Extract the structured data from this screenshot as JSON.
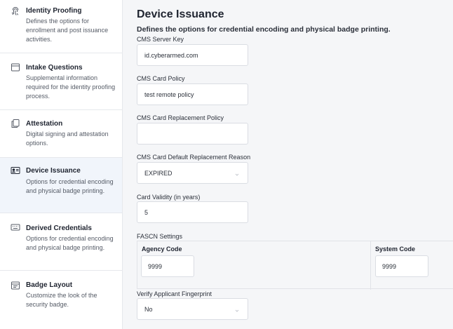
{
  "sidebar": {
    "items": [
      {
        "title": "Identity Proofing",
        "desc": "Defines the options for enrollment and post issuance activities.",
        "icon": "fingerprint-icon",
        "active": false
      },
      {
        "title": "Intake Questions",
        "desc": "Supplemental information required for the identity proofing process.",
        "icon": "inbox-icon",
        "active": false
      },
      {
        "title": "Attestation",
        "desc": "Digital signing and attestation options.",
        "icon": "copy-document-icon",
        "active": false
      },
      {
        "title": "Device Issuance",
        "desc": "Options for credential encoding and physical badge printing.",
        "icon": "id-card-icon",
        "active": true
      },
      {
        "title": "Derived Credentials",
        "desc": "Options for credential encoding and physical badge printing.",
        "icon": "keyboard-icon",
        "active": false
      },
      {
        "title": "Badge Layout",
        "desc": "Customize the look of the security badge.",
        "icon": "layout-icon",
        "active": false
      }
    ]
  },
  "main": {
    "title": "Device Issuance",
    "subtitle": "Defines the options for credential encoding and physical badge printing.",
    "fields": {
      "cms_server_key": {
        "label": "CMS Server Key",
        "value": "id.cyberarmed.com"
      },
      "cms_card_policy": {
        "label": "CMS Card Policy",
        "value": "test remote policy"
      },
      "cms_card_replacement_policy": {
        "label": "CMS Card Replacement Policy",
        "value": ""
      },
      "cms_card_default_replacement_reason": {
        "label": "CMS Card Default Replacement Reason",
        "value": "EXPIRED"
      },
      "card_validity": {
        "label": "Card Validity (in years)",
        "value": "5"
      },
      "fascn": {
        "label": "FASCN Settings",
        "agency_code_label": "Agency Code",
        "agency_code_value": "9999",
        "system_code_label": "System Code",
        "system_code_value": "9999"
      },
      "verify_fingerprint": {
        "label": "Verify Applicant Fingerprint",
        "value": "No"
      }
    }
  },
  "colors": {
    "active_bg": "#f1f5fb",
    "main_bg": "#f5f6f8",
    "border": "#dadde3"
  }
}
